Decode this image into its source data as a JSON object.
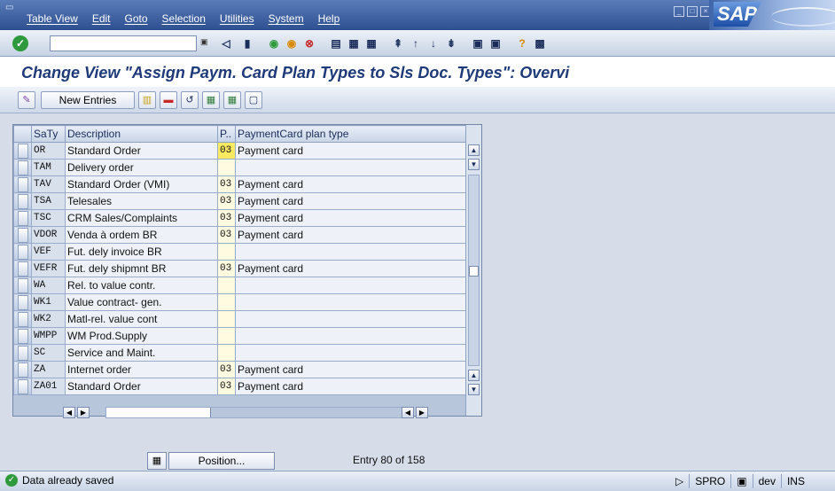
{
  "menubar": {
    "items": [
      "Table View",
      "Edit",
      "Goto",
      "Selection",
      "Utilities",
      "System",
      "Help"
    ]
  },
  "command_field": {
    "value": ""
  },
  "screen_title": "Change View \"Assign Paym. Card Plan Types to Sls Doc. Types\": Overvi",
  "app_toolbar": {
    "new_entries_label": "New Entries"
  },
  "table": {
    "headers": {
      "saty": "SaTy",
      "description": "Description",
      "p": "P..",
      "plan_type": "PaymentCard plan type"
    },
    "rows": [
      {
        "saty": "OR",
        "description": "Standard Order",
        "p": "03",
        "plan_type": "Payment card",
        "active": true
      },
      {
        "saty": "TAM",
        "description": "Delivery order",
        "p": "",
        "plan_type": ""
      },
      {
        "saty": "TAV",
        "description": "Standard Order (VMI)",
        "p": "03",
        "plan_type": "Payment card"
      },
      {
        "saty": "TSA",
        "description": "Telesales",
        "p": "03",
        "plan_type": "Payment card"
      },
      {
        "saty": "TSC",
        "description": "CRM Sales/Complaints",
        "p": "03",
        "plan_type": "Payment card"
      },
      {
        "saty": "VDOR",
        "description": "Venda à ordem BR",
        "p": "03",
        "plan_type": "Payment card"
      },
      {
        "saty": "VEF",
        "description": "Fut. dely invoice BR",
        "p": "",
        "plan_type": ""
      },
      {
        "saty": "VEFR",
        "description": "Fut. dely shipmnt BR",
        "p": "03",
        "plan_type": "Payment card"
      },
      {
        "saty": "WA",
        "description": "Rel. to value contr.",
        "p": "",
        "plan_type": ""
      },
      {
        "saty": "WK1",
        "description": "Value contract- gen.",
        "p": "",
        "plan_type": ""
      },
      {
        "saty": "WK2",
        "description": "Matl-rel. value cont",
        "p": "",
        "plan_type": ""
      },
      {
        "saty": "WMPP",
        "description": "WM Prod.Supply",
        "p": "",
        "plan_type": ""
      },
      {
        "saty": "SC",
        "description": "Service and Maint.",
        "p": "",
        "plan_type": ""
      },
      {
        "saty": "ZA",
        "description": "Internet order",
        "p": "03",
        "plan_type": "Payment card"
      },
      {
        "saty": "ZA01",
        "description": "Standard Order",
        "p": "03",
        "plan_type": "Payment card"
      }
    ]
  },
  "position_button_label": "Position...",
  "entry_count": "Entry 80 of 158",
  "status": {
    "message": "Data already saved",
    "transaction": "SPRO",
    "system": "dev",
    "mode": "INS"
  },
  "colors": {
    "menubar": "#2e4f91",
    "title": "#1f3a78",
    "active_cell": "#f9ea62",
    "ok": "#2f9a3c"
  }
}
